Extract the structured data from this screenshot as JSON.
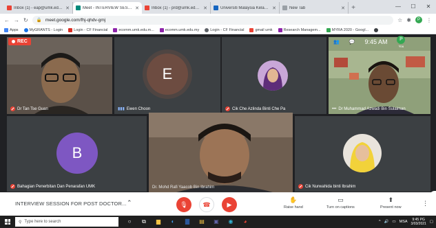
{
  "browser": {
    "tabs": [
      {
        "title": "Inbox (1) - eap@umk.edu.my",
        "favicon_color": "#ea4335",
        "active": false
      },
      {
        "title": "Meet - INTERVIEW SESSIO",
        "favicon_color": "#00897b",
        "active": true
      },
      {
        "title": "Inbox (1) - prd@umk.edu.my",
        "favicon_color": "#ea4335",
        "active": false
      },
      {
        "title": "Universiti Malaysia Kelantan",
        "favicon_color": "#1565c0",
        "active": false
      },
      {
        "title": "New Tab",
        "favicon_color": "#9aa0a6",
        "active": false
      }
    ],
    "url": "meet.google.com/fhj-qhdv-gmj",
    "profile_initial": "P",
    "bookmarks": [
      {
        "label": "Apps",
        "color": "#4285f4"
      },
      {
        "label": "MyGRANTS - Login",
        "color": "#1a73e8"
      },
      {
        "label": "Login - CF Financial",
        "color": "#d93025"
      },
      {
        "label": "ecomm.umk.edu.m...",
        "color": "#8e24aa"
      },
      {
        "label": "ecomm.umk.edu.my",
        "color": "#8e24aa"
      },
      {
        "label": "Login - CF Financial",
        "color": "#5f6368"
      },
      {
        "label": "gmail umk",
        "color": "#ea4335"
      },
      {
        "label": "Research Managem...",
        "color": "#8e24aa"
      },
      {
        "label": "MYRA 2020 - Googl...",
        "color": "#34a853"
      }
    ]
  },
  "meet": {
    "recording_label": "REC",
    "time": "9:45 AM",
    "self_label": "You",
    "self_initial": "P",
    "participants": [
      {
        "name": "Dr Tan Tse Guan",
        "muted": true
      },
      {
        "name": "Ewen Choon",
        "muted": false,
        "initial": "E",
        "avatar_color": "#6d4c41"
      },
      {
        "name": "Cik Che Azlinda Binti Che Pa",
        "muted": true
      },
      {
        "name": "Dr Muhammad Azwadi Bin Sulaiman",
        "muted": false
      },
      {
        "name": "Bahagian Penerbitan Dan Penarafan UMK",
        "muted": true,
        "initial": "B",
        "avatar_color": "#7e57c2"
      },
      {
        "name": "Dr. Mohd Rafi Yaacob Bin Ibrahim",
        "muted": false
      },
      {
        "name": "Cik Nurwahida binti Ibrahim",
        "muted": true
      }
    ],
    "controls": {
      "meeting_title": "INTERVIEW SESSION FOR POST DOCTOR...",
      "raise_hand": "Raise hand",
      "captions": "Turn on captions",
      "present": "Present now"
    }
  },
  "taskbar": {
    "search_placeholder": "Type here to search",
    "lang": "MSA",
    "clock_time": "9:45 PG",
    "clock_date": "3/03/2021"
  },
  "colors": {
    "accent_red": "#ea4335",
    "meet_bg": "#202124",
    "tile_bg": "#3c4043"
  }
}
